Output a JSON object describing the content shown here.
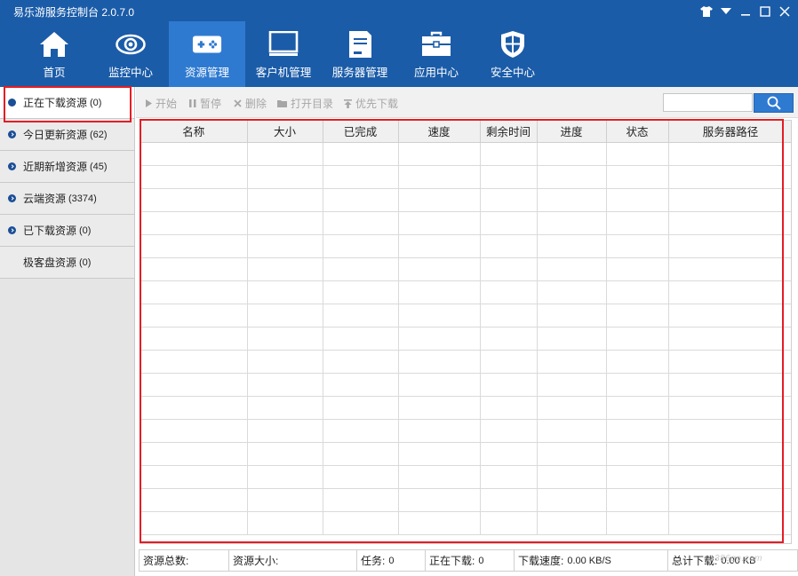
{
  "app": {
    "title": "易乐游服务控制台 2.0.7.0"
  },
  "window_controls": [
    "shirt-icon",
    "menu-down-icon",
    "minimize-icon",
    "maximize-icon",
    "close-icon"
  ],
  "nav": {
    "items": [
      {
        "label": "首页",
        "icon": "home-icon"
      },
      {
        "label": "监控中心",
        "icon": "eye-icon"
      },
      {
        "label": "资源管理",
        "icon": "gamepad-icon",
        "active": true
      },
      {
        "label": "客户机管理",
        "icon": "monitor-icon"
      },
      {
        "label": "服务器管理",
        "icon": "server-icon"
      },
      {
        "label": "应用中心",
        "icon": "toolbox-icon"
      },
      {
        "label": "安全中心",
        "icon": "shield-icon"
      }
    ]
  },
  "sidebar": {
    "items": [
      {
        "label": "正在下载资源",
        "count": "(0)",
        "bullet": "dot",
        "active": true
      },
      {
        "label": "今日更新资源",
        "count": "(62)",
        "bullet": "arrow"
      },
      {
        "label": "近期新增资源",
        "count": "(45)",
        "bullet": "arrow"
      },
      {
        "label": "云端资源",
        "count": "(3374)",
        "bullet": "arrow"
      },
      {
        "label": "已下载资源",
        "count": "(0)",
        "bullet": "arrow"
      },
      {
        "label": "极客盘资源",
        "count": "(0)",
        "bullet": "none"
      }
    ]
  },
  "toolbar": {
    "start": "开始",
    "pause": "暂停",
    "delete": "删除",
    "open_dir": "打开目录",
    "priority": "优先下载",
    "search_placeholder": ""
  },
  "table": {
    "columns": [
      "名称",
      "大小",
      "已完成",
      "速度",
      "剩余时间",
      "进度",
      "状态",
      "服务器路径"
    ],
    "rows": []
  },
  "status": {
    "total_label": "资源总数:",
    "total_value": "",
    "size_label": "资源大小:",
    "size_value": "",
    "tasks_label": "任务:",
    "tasks_value": "0",
    "downloading_label": "正在下载:",
    "downloading_value": "0",
    "speed_label": "下载速度:",
    "speed_value": "0.00 KB/S",
    "total_dl_label": "总计下载:",
    "total_dl_value": "0.00 KB"
  },
  "watermark": "386go.com",
  "colors": {
    "header": "#1b5ca8",
    "active_tab": "#2f7ad1",
    "highlight": "#e41d24"
  }
}
